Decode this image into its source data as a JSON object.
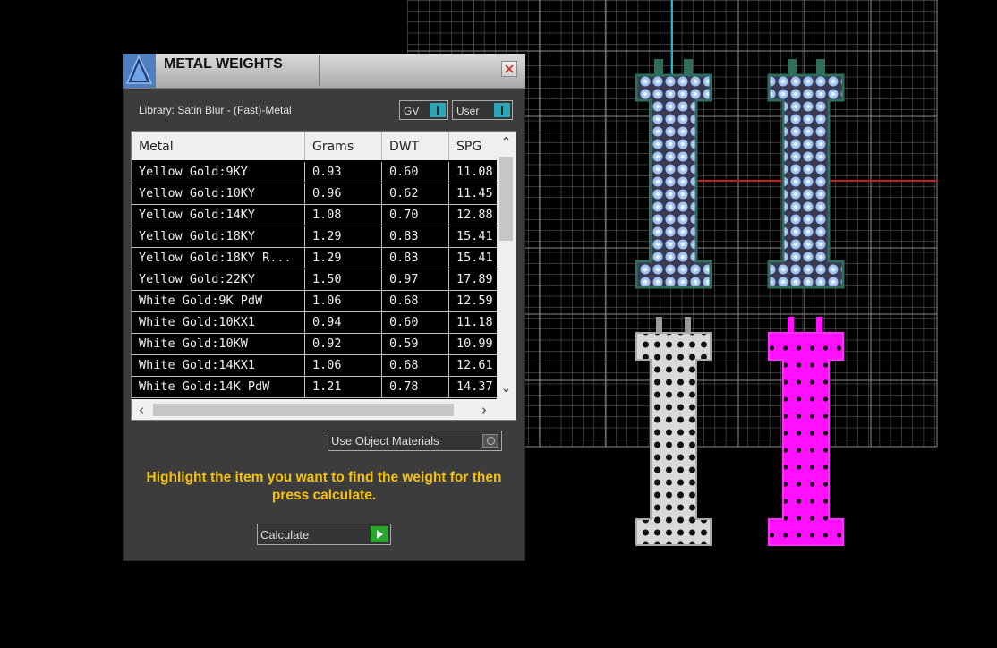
{
  "panel": {
    "title": "METAL WEIGHTS",
    "library_label": "Library: Satin Blur - (Fast)-Metal",
    "gv_toggle_label": "GV",
    "user_toggle_label": "User",
    "columns": [
      "Metal",
      "Grams",
      "DWT",
      "SPG"
    ],
    "rows": [
      [
        "Yellow Gold:9KY",
        "0.93",
        "0.60",
        "11.08"
      ],
      [
        "Yellow Gold:10KY",
        "0.96",
        "0.62",
        "11.45"
      ],
      [
        "Yellow Gold:14KY",
        "1.08",
        "0.70",
        "12.88"
      ],
      [
        "Yellow Gold:18KY",
        "1.29",
        "0.83",
        "15.41"
      ],
      [
        "Yellow Gold:18KY R...",
        "1.29",
        "0.83",
        "15.41"
      ],
      [
        "Yellow Gold:22KY",
        "1.50",
        "0.97",
        "17.89"
      ],
      [
        "White Gold:9K PdW",
        "1.06",
        "0.68",
        "12.59"
      ],
      [
        "White Gold:10KX1",
        "0.94",
        "0.60",
        "11.18"
      ],
      [
        "White Gold:10KW",
        "0.92",
        "0.59",
        "10.99"
      ],
      [
        "White Gold:14KX1",
        "1.06",
        "0.68",
        "12.61"
      ],
      [
        "White Gold:14K PdW",
        "1.21",
        "0.78",
        "14.37"
      ]
    ],
    "use_object_materials_label": "Use Object Materials",
    "hint_text": "Highlight the item you want to find the weight for then press calculate.",
    "calculate_label": "Calculate"
  },
  "colors": {
    "accent_teal": "#2aa6b8",
    "hint_yellow": "#f4c20d",
    "calculate_green": "#29a82e",
    "magenta_material": "#ff00ff",
    "blue_material": "#8fb6ee"
  }
}
